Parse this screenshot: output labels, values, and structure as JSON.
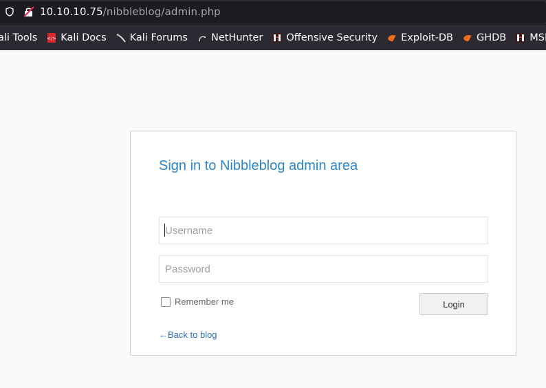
{
  "browser": {
    "url_host": "10.10.10.75",
    "url_path": "/nibbleblog/admin.php"
  },
  "bookmarks": [
    {
      "label": "ali Tools",
      "icon": "kali-tools-icon"
    },
    {
      "label": "Kali Docs",
      "icon": "kali-docs-icon"
    },
    {
      "label": "Kali Forums",
      "icon": "kali-forums-icon"
    },
    {
      "label": "NetHunter",
      "icon": "nethunter-icon"
    },
    {
      "label": "Offensive Security",
      "icon": "offensive-security-icon"
    },
    {
      "label": "Exploit-DB",
      "icon": "exploit-db-icon"
    },
    {
      "label": "GHDB",
      "icon": "ghdb-icon"
    },
    {
      "label": "MSFU",
      "icon": "msfu-icon"
    }
  ],
  "login": {
    "title": "Sign in to Nibbleblog admin area",
    "username_placeholder": "Username",
    "password_placeholder": "Password",
    "remember_label": "Remember me",
    "login_label": "Login",
    "back_label": "←Back to blog"
  },
  "colors": {
    "title": "#2a85c7",
    "link": "#2a6fb5"
  }
}
